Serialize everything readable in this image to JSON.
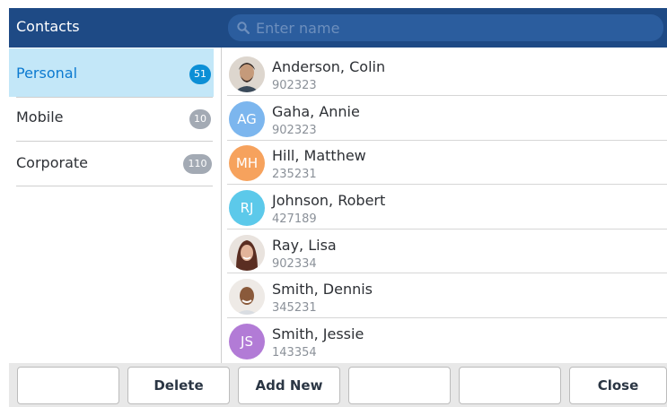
{
  "header": {
    "title": "Contacts",
    "search_placeholder": "Enter name"
  },
  "categories": [
    {
      "label": "Personal",
      "count": "51",
      "active": true
    },
    {
      "label": "Mobile",
      "count": "10",
      "active": false
    },
    {
      "label": "Corporate",
      "count": "110",
      "active": false
    }
  ],
  "contacts": [
    {
      "name": "Anderson, Colin",
      "number": "902323",
      "avatar": "photo",
      "color": "#8a6d5a"
    },
    {
      "name": "Gaha, Annie",
      "number": "902323",
      "initials": "AG",
      "color": "#7cb6ee"
    },
    {
      "name": "Hill, Matthew",
      "number": "235231",
      "initials": "MH",
      "color": "#f6a25d"
    },
    {
      "name": "Johnson, Robert",
      "number": "427189",
      "initials": "RJ",
      "color": "#5cc9ea"
    },
    {
      "name": "Ray, Lisa",
      "number": "902334",
      "avatar": "photo",
      "color": "#6b3b2f"
    },
    {
      "name": "Smith, Dennis",
      "number": "345231",
      "avatar": "photo",
      "color": "#7a5237"
    },
    {
      "name": "Smith, Jessie",
      "number": "143354",
      "initials": "JS",
      "color": "#b27bd6"
    }
  ],
  "footer": {
    "buttons": [
      "",
      "Delete",
      "Add New",
      "",
      "",
      "Close"
    ]
  },
  "icons": {
    "search": "search-icon"
  }
}
